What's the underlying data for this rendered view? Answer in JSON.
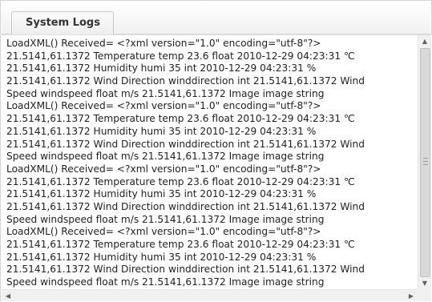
{
  "panel": {
    "tab_label": "System Logs"
  },
  "log": {
    "lines": [
      " LoadXML() Received= <?xml version=\"1.0\" encoding=\"utf-8\"?>",
      "21.5141,61.1372 Temperature temp 23.6 float 2010-12-29 04:23:31 ℃",
      "21.5141,61.1372 Humidity humi 35 int 2010-12-29 04:23:31 %",
      "21.5141,61.1372 Wind Direction winddirection int 21.5141,61.1372 Wind",
      "Speed windspeed float m/s 21.5141,61.1372 Image image string",
      "LoadXML() Received= <?xml version=\"1.0\" encoding=\"utf-8\"?>",
      "21.5141,61.1372 Temperature temp 23.6 float 2010-12-29 04:23:31 ℃",
      "21.5141,61.1372 Humidity humi 35 int 2010-12-29 04:23:31 %",
      "21.5141,61.1372 Wind Direction winddirection int 21.5141,61.1372 Wind",
      "Speed windspeed float m/s 21.5141,61.1372 Image image string",
      " LoadXML() Received= <?xml version=\"1.0\" encoding=\"utf-8\"?>",
      "21.5141,61.1372 Temperature temp 23.6 float 2010-12-29 04:23:31 ℃",
      "21.5141,61.1372 Humidity humi 35 int 2010-12-29 04:23:31 %",
      "21.5141,61.1372 Wind Direction winddirection int 21.5141,61.1372 Wind",
      "Speed windspeed float m/s 21.5141,61.1372 Image image string",
      " LoadXML() Received= <?xml version=\"1.0\" encoding=\"utf-8\"?>",
      "21.5141,61.1372 Temperature temp 23.6 float 2010-12-29 04:23:31 ℃",
      "21.5141,61.1372 Humidity humi 35 int 2010-12-29 04:23:31 %",
      "21.5141,61.1372 Wind Direction winddirection int 21.5141,61.1372 Wind",
      "Speed windspeed float m/s 21.5141,61.1372 Image image string"
    ]
  },
  "scrollbars": {
    "up_arrow_icon": "triangle-up",
    "down_arrow_icon": "triangle-down",
    "left_arrow_icon": "triangle-left",
    "right_arrow_icon": "triangle-right"
  }
}
